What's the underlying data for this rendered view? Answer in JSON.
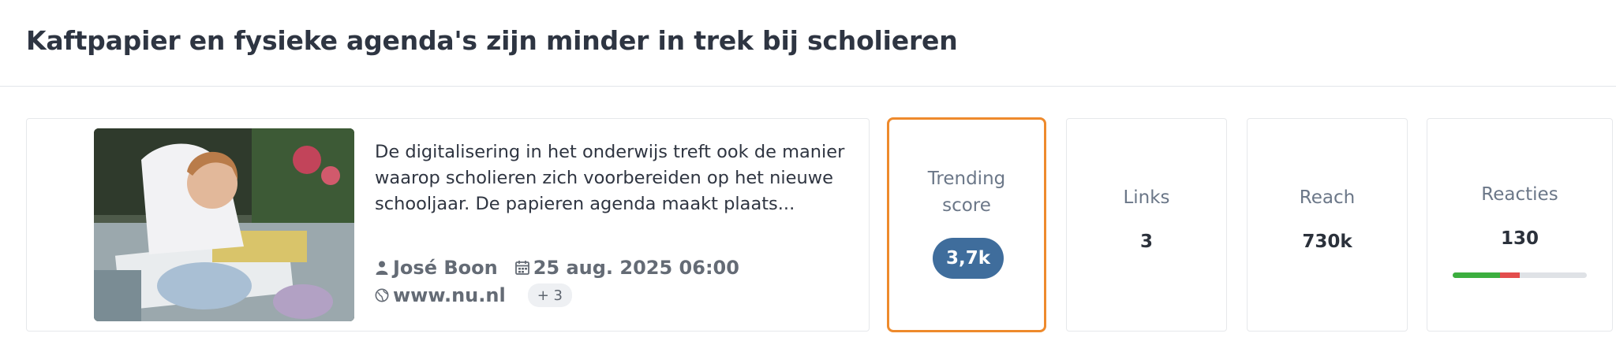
{
  "page": {
    "title": "Kaftpapier en fysieke agenda's zijn minder in trek bij scholieren"
  },
  "article": {
    "summary": "De digitalisering in het onderwijs treft ook de manier waarop scholieren zich voorbereiden op het nieuwe schooljaar. De papieren agenda maakt plaats...",
    "author": "José Boon",
    "date": "25 aug. 2025 06:00",
    "source": "www.nu.nl",
    "more_sources": "+ 3",
    "icons": {
      "author": "person-icon",
      "date": "calendar-icon",
      "source": "globe-icon"
    }
  },
  "metrics": {
    "trending": {
      "label": "Trending score",
      "value": "3,7k"
    },
    "links": {
      "label": "Links",
      "value": "3"
    },
    "reach": {
      "label": "Reach",
      "value": "730k"
    },
    "reacties": {
      "label": "Reacties",
      "value": "130",
      "sentiment": {
        "positive": 0.35,
        "negative": 0.15,
        "neutral": 0.5
      }
    }
  },
  "colors": {
    "trending_border": "#ee8a2c",
    "trending_pill": "#3f6d9c",
    "positive": "#3cae3f",
    "negative": "#e34d4d",
    "neutral": "#dfe2e6"
  }
}
